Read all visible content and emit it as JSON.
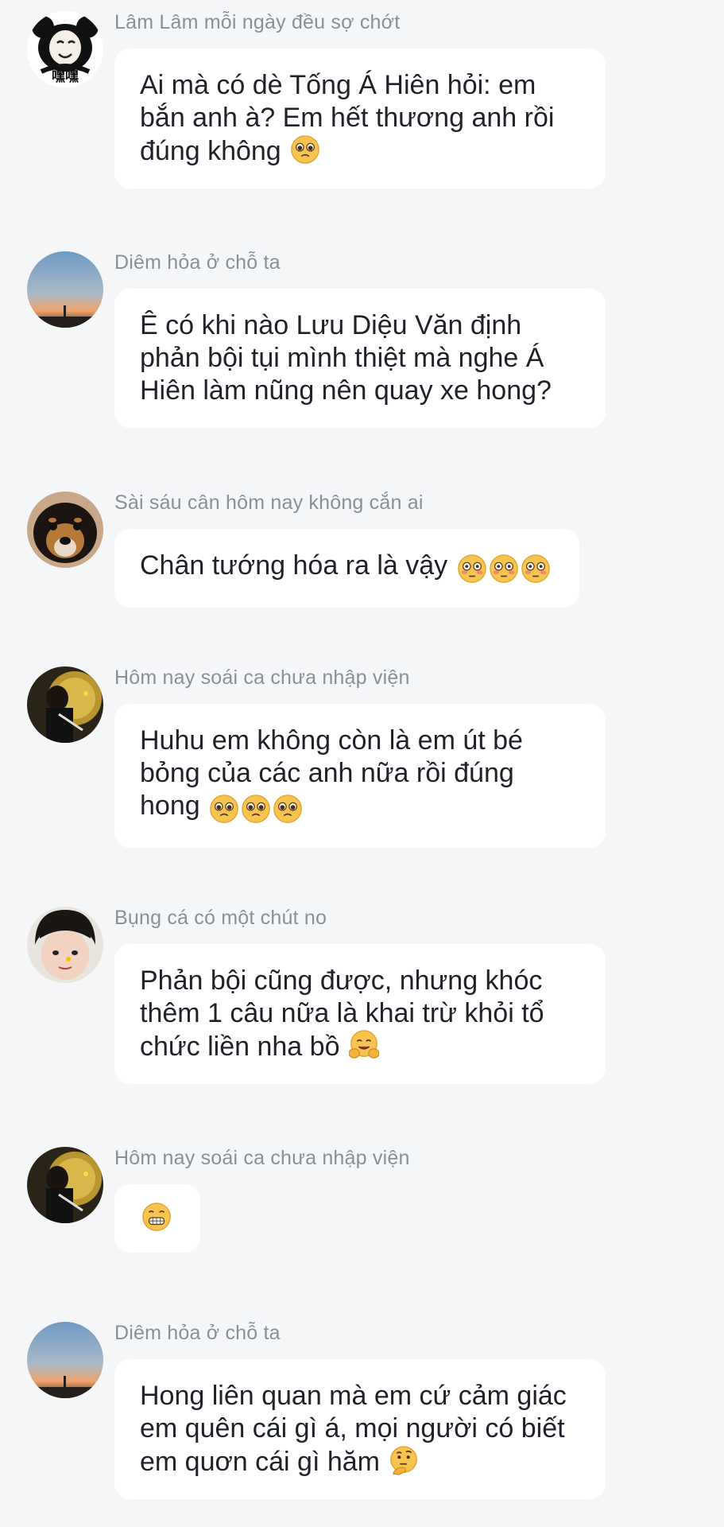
{
  "messages": [
    {
      "sender": "Lâm Lâm mỗi ngày đều sợ chớt",
      "text": "Ai mà có dè Tống Á Hiên hỏi: em bắn anh à? Em hết thương anh rồi đúng không",
      "emojis": [
        "pleading-face"
      ],
      "avatar": "panda-meme-avatar",
      "avatar_caption": "嘿嘿"
    },
    {
      "sender": "Diêm hỏa ở chỗ ta",
      "text": "Ê có khi nào Lưu Diệu Văn định phản bội tụi mình thiệt mà nghe Á Hiên làm nũng nên quay xe hong?",
      "emojis": [],
      "avatar": "sunset-avatar"
    },
    {
      "sender": "Sài sáu cân hôm nay không cắn ai",
      "text": "Chân tướng hóa ra là vậy",
      "emojis": [
        "flushed-face",
        "flushed-face",
        "flushed-face"
      ],
      "avatar": "dog-avatar"
    },
    {
      "sender": "Hôm nay soái ca chưa nhập viện",
      "text": "Huhu em không còn là em út bé bỏng của các anh nữa rồi đúng hong",
      "emojis": [
        "pleading-face",
        "pleading-face",
        "pleading-face"
      ],
      "avatar": "boy-golden-avatar"
    },
    {
      "sender": "Bụng cá có một chút no",
      "text": "Phản bội cũng được, nhưng khóc thêm 1 câu nữa là khai trừ khỏi tổ chức liền nha bồ",
      "emojis": [
        "hugging-face"
      ],
      "avatar": "boy-face-avatar"
    },
    {
      "sender": "Hôm nay soái ca chưa nhập viện",
      "text": "",
      "emojis": [
        "grimacing-face"
      ],
      "avatar": "boy-golden-avatar"
    },
    {
      "sender": "Diêm hỏa ở chỗ ta",
      "text": "Hong liên quan mà em cứ cảm giác em quên cái gì á, mọi người có biết em quơn cái gì hăm",
      "emojis": [
        "thinking-face"
      ],
      "avatar": "sunset-avatar"
    }
  ]
}
